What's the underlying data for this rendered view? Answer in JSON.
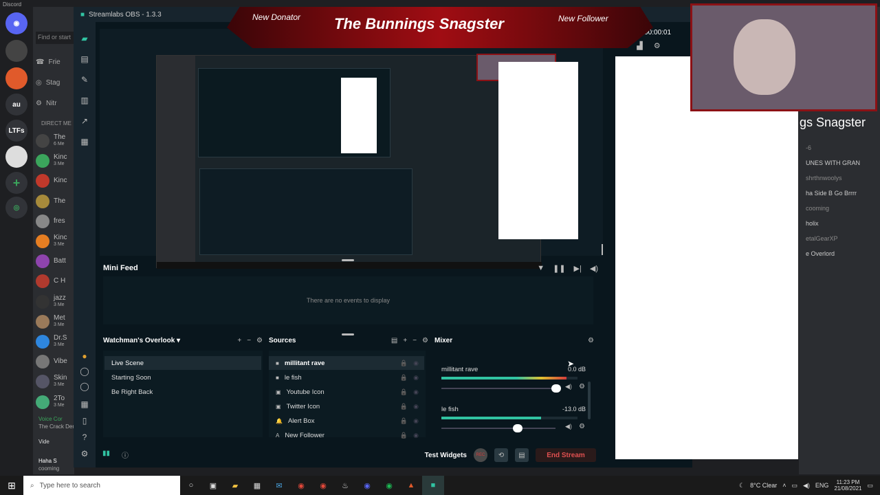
{
  "discord": {
    "title": "Discord",
    "search_placeholder": "Find or start",
    "friends": "Frie",
    "stage": "Stag",
    "nitro": "Nitr",
    "direct_header": "DIRECT ME",
    "servers": [
      {
        "label": "au",
        "color": "#313338"
      },
      {
        "label": "LTFs",
        "color": "#313338"
      }
    ],
    "dms": [
      {
        "name": "The",
        "sub": "6 Me"
      },
      {
        "name": "Kinc",
        "sub": "3 Me"
      },
      {
        "name": "Kinc",
        "sub": ""
      },
      {
        "name": "The",
        "sub": ""
      },
      {
        "name": "fres",
        "sub": ""
      },
      {
        "name": "Kinc",
        "sub": "3 Me"
      },
      {
        "name": "Batt",
        "sub": ""
      },
      {
        "name": "C H",
        "sub": ""
      },
      {
        "name": "jazz",
        "sub": "3 Me"
      },
      {
        "name": "Met",
        "sub": "3 Me"
      },
      {
        "name": "Dr.S",
        "sub": "3 Me"
      },
      {
        "name": "Vibe",
        "sub": ""
      },
      {
        "name": "Skin",
        "sub": "3 Me"
      },
      {
        "name": "2To",
        "sub": "3 Me"
      }
    ],
    "voice": "Voice Cor",
    "voice_sub": "The Crack Den",
    "video": "Vide",
    "user": "Haha S",
    "user_sub": "cooming"
  },
  "obs": {
    "title": "Streamlabs OBS - 1.3.3",
    "live": "Live 00:00:01",
    "minifeed_title": "Mini Feed",
    "minifeed_empty": "There are no events to display",
    "scenes_title": "Watchman's Overlook",
    "scenes": [
      "Live Scene",
      "Starting Soon",
      "Be Right Back"
    ],
    "sources_title": "Sources",
    "sources": [
      {
        "label": "millitant rave",
        "icon": "■"
      },
      {
        "label": "le fish",
        "icon": "■"
      },
      {
        "label": "Youtube Icon",
        "icon": "▣"
      },
      {
        "label": "Twitter Icon",
        "icon": "▣"
      },
      {
        "label": "Alert Box",
        "icon": "🔔"
      },
      {
        "label": "New Follower",
        "icon": "A"
      }
    ],
    "mixer_title": "Mixer",
    "mixer": [
      {
        "name": "millitant rave",
        "db": "0.0 dB",
        "level": 0.92
      },
      {
        "name": "le fish",
        "db": "-13.0 dB",
        "level": 0.73
      }
    ],
    "test_widgets": "Test Widgets",
    "rec": "REC",
    "end_stream": "End Stream"
  },
  "overlay": {
    "left": "New Donator",
    "title": "The Bunnings Snagster",
    "right": "New Follower",
    "side_name": "gs Snagster"
  },
  "chat": {
    "lines": [
      "-6",
      "UNES WITH GRAN",
      "shrthnwoolys",
      "ha Side B Go Brrrr",
      "cooming",
      "holix",
      "etalGearXP",
      "e Overlord"
    ]
  },
  "taskbar": {
    "search": "Type here to search",
    "weather": "8°C  Clear",
    "lang": "ENG",
    "time": "11:23 PM",
    "date": "21/08/2021"
  },
  "colors": {
    "accent": "#31c3a2",
    "red": "#d43b3b",
    "discord_blurple": "#5865f2"
  }
}
